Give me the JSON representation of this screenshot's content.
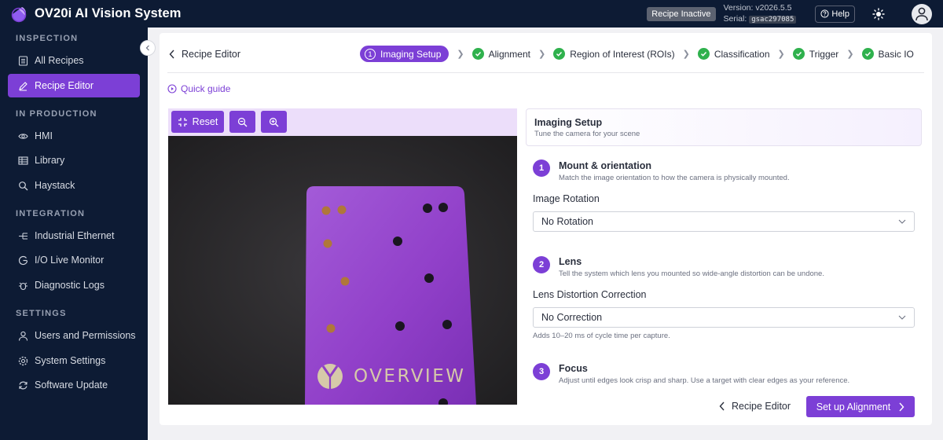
{
  "app": {
    "title": "OV20i AI Vision System"
  },
  "topbar": {
    "status_badge": "Recipe Inactive",
    "version_label": "Version: v2026.5.5",
    "serial_label": "Serial:",
    "serial_value": "gsac297085",
    "help_label": "Help"
  },
  "sidebar": {
    "sections": [
      {
        "title": "INSPECTION",
        "items": [
          "All Recipes",
          "Recipe Editor"
        ]
      },
      {
        "title": "IN PRODUCTION",
        "items": [
          "HMI",
          "Library",
          "Haystack"
        ]
      },
      {
        "title": "INTEGRATION",
        "items": [
          "Industrial Ethernet",
          "I/O Live Monitor",
          "Diagnostic Logs"
        ]
      },
      {
        "title": "SETTINGS",
        "items": [
          "Users and Permissions",
          "System Settings",
          "Software Update"
        ]
      }
    ],
    "active_item": "Recipe Editor"
  },
  "header": {
    "back_label": "Recipe Editor",
    "steps": [
      {
        "num": "1",
        "label": "Imaging Setup",
        "state": "current"
      },
      {
        "label": "Alignment",
        "state": "done"
      },
      {
        "label": "Region of Interest (ROIs)",
        "state": "done"
      },
      {
        "label": "Classification",
        "state": "done"
      },
      {
        "label": "Trigger",
        "state": "done"
      },
      {
        "label": "Basic IO",
        "state": "done"
      }
    ]
  },
  "quick_guide": "Quick guide",
  "viewer": {
    "reset_label": "Reset",
    "plate_text": "OVERVIEW"
  },
  "panel": {
    "title": "Imaging Setup",
    "subtitle": "Tune the camera for your scene",
    "sections": [
      {
        "num": "1",
        "title": "Mount & orientation",
        "subtitle": "Match the image orientation to how the camera is physically mounted.",
        "field_label": "Image Rotation",
        "value": "No Rotation"
      },
      {
        "num": "2",
        "title": "Lens",
        "subtitle": "Tell the system which lens you mounted so wide-angle distortion can be undone.",
        "field_label": "Lens Distortion Correction",
        "value": "No Correction",
        "hint": "Adds 10–20 ms of cycle time per capture."
      },
      {
        "num": "3",
        "title": "Focus",
        "subtitle": "Adjust until edges look crisp and sharp. Use a target with clear edges as your reference."
      }
    ]
  },
  "footer": {
    "back_label": "Recipe Editor",
    "next_label": "Set up Alignment"
  },
  "icons": {
    "logo": "logo-icon",
    "help": "help-icon",
    "theme": "sun-icon",
    "user": "user-icon",
    "all_recipes": "list-icon",
    "recipe_editor": "pencil-icon",
    "hmi": "eye-icon",
    "library": "grid-icon",
    "haystack": "search-icon",
    "ethernet": "network-icon",
    "io": "io-icon",
    "logs": "bug-icon",
    "users": "user-icon",
    "settings": "gear-icon",
    "update": "refresh-icon"
  },
  "colors": {
    "accent": "#7c3fd6",
    "sidebar_bg": "#0d1b34",
    "success": "#2fb14d"
  }
}
